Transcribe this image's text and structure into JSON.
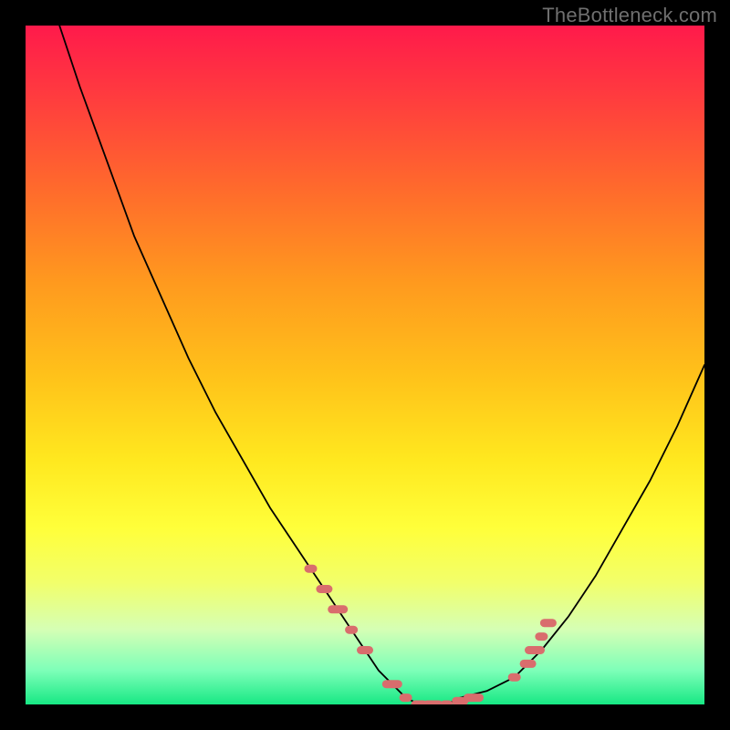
{
  "watermark": "TheBottleneck.com",
  "colors": {
    "curve": "#000000",
    "marker": "#d96d6d",
    "background_top": "#ff1a4b",
    "background_bottom": "#17e884",
    "frame": "#000000"
  },
  "chart_data": {
    "type": "line",
    "title": "",
    "xlabel": "",
    "ylabel": "",
    "xlim": [
      0,
      100
    ],
    "ylim": [
      0,
      100
    ],
    "grid": false,
    "x": [
      5,
      8,
      12,
      16,
      20,
      24,
      28,
      32,
      36,
      40,
      42,
      44,
      46,
      48,
      50,
      52,
      54,
      56,
      58,
      60,
      62,
      64,
      68,
      72,
      76,
      80,
      84,
      88,
      92,
      96,
      100
    ],
    "y": [
      100,
      91,
      80,
      69,
      60,
      51,
      43,
      36,
      29,
      23,
      20,
      17,
      14,
      11,
      8,
      5,
      3,
      1,
      0,
      0,
      0,
      1,
      2,
      4,
      8,
      13,
      19,
      26,
      33,
      41,
      50
    ],
    "markers": {
      "x": [
        42,
        44,
        46,
        48,
        50,
        54,
        56,
        58,
        60,
        62,
        64,
        66,
        72,
        74,
        75,
        76,
        77
      ],
      "y": [
        20,
        17,
        14,
        11,
        8,
        3,
        1,
        0,
        0,
        0,
        0.5,
        1,
        4,
        6,
        8,
        10,
        12
      ]
    }
  }
}
